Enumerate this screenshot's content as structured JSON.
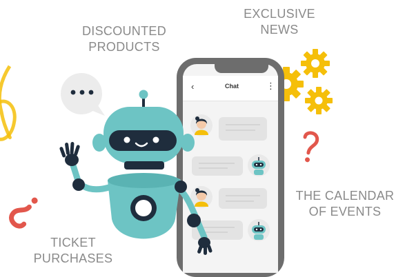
{
  "labels": {
    "discounted_products": [
      "DISCOUNTED",
      "PRODUCTS"
    ],
    "exclusive_news": [
      "EXCLUSIVE",
      "NEWS"
    ],
    "calendar_of_events": [
      "THE CALENDAR",
      "OF EVENTS"
    ],
    "ticket_purchases": [
      "TICKET",
      "PURCHASES"
    ]
  },
  "phone": {
    "chat_title": "Chat",
    "back_icon": "chevron-left-icon",
    "menu_icon": "more-vertical-icon"
  },
  "chat_messages": [
    {
      "sender": "user",
      "avatar": "woman-avatar"
    },
    {
      "sender": "bot",
      "avatar": "robot-avatar"
    },
    {
      "sender": "user",
      "avatar": "woman-avatar"
    },
    {
      "sender": "bot",
      "avatar": "robot-avatar"
    }
  ],
  "colors": {
    "robot_teal": "#6dc4c4",
    "robot_dark": "#1f2d3d",
    "gear_yellow": "#f5bf0a",
    "accent_red": "#e2574c",
    "phone_frame": "#6d6d6d",
    "label_gray": "#8a8a8a"
  }
}
